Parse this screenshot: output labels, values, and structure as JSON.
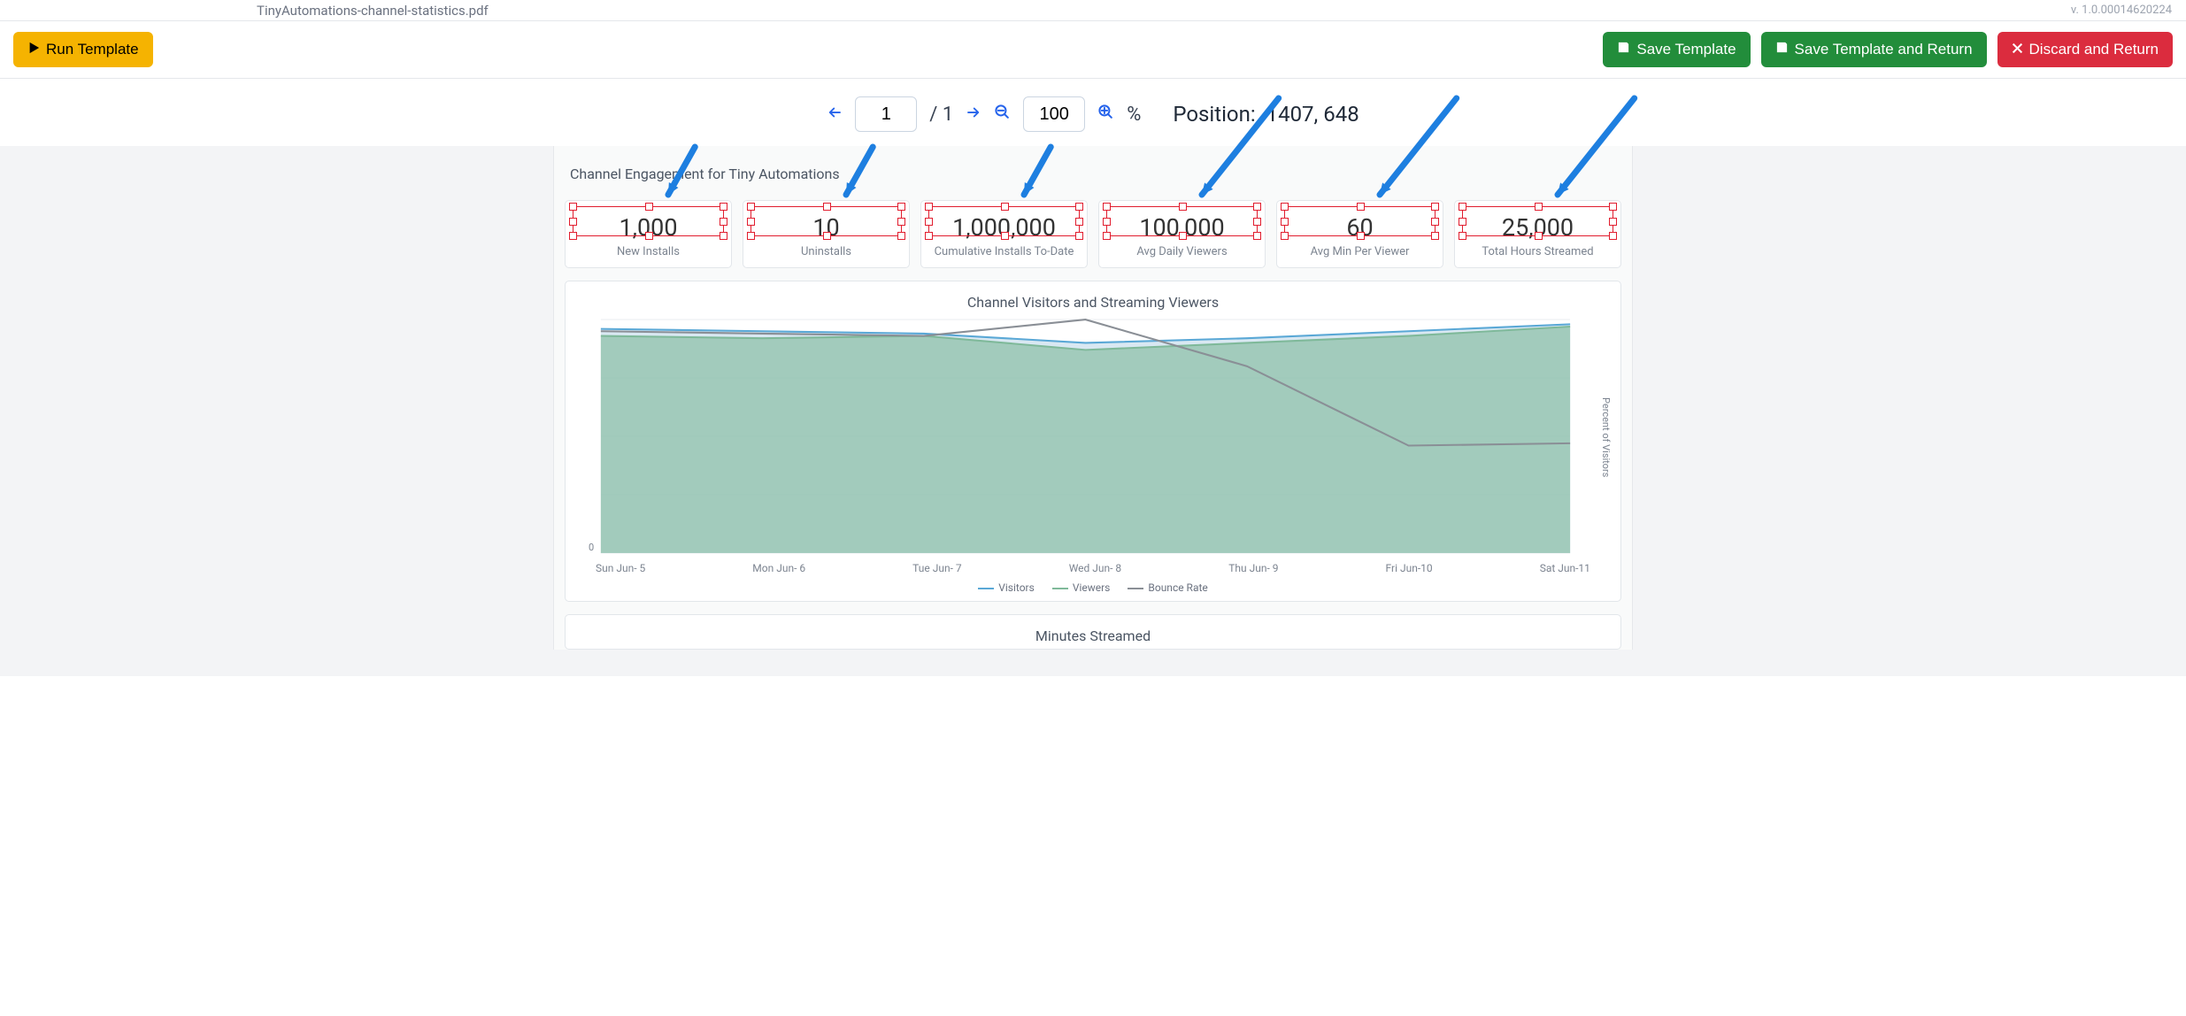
{
  "tab": {
    "filename": "TinyAutomations-channel-statistics.pdf",
    "version": "v. 1.0.00014620224"
  },
  "toolbar": {
    "run_label": "Run Template",
    "save_label": "Save Template",
    "save_return_label": "Save Template and Return",
    "discard_label": "Discard and Return"
  },
  "viewer": {
    "page_current": "1",
    "page_total": "1",
    "zoom": "100",
    "position_label": "Position:",
    "position_value": "1407, 648"
  },
  "report": {
    "title": "Channel Engagement for Tiny Automations",
    "kpis": [
      {
        "value": "1,000",
        "label": "New Installs"
      },
      {
        "value": "10",
        "label": "Uninstalls"
      },
      {
        "value": "1,000,000",
        "label": "Cumulative Installs To-Date"
      },
      {
        "value": "100,000",
        "label": "Avg Daily Viewers"
      },
      {
        "value": "60",
        "label": "Avg Min Per Viewer"
      },
      {
        "value": "25,000",
        "label": "Total Hours Streamed"
      }
    ],
    "chart1": {
      "title": "Channel Visitors and Streaming Viewers",
      "y_right": "Percent of Visitors",
      "zero": "0",
      "legend": [
        {
          "name": "Visitors",
          "color": "#5aa8d6"
        },
        {
          "name": "Viewers",
          "color": "#7fb99a"
        },
        {
          "name": "Bounce Rate",
          "color": "#8a8f96"
        }
      ]
    },
    "chart2": {
      "title": "Minutes Streamed"
    }
  },
  "chart_data": {
    "type": "area",
    "categories": [
      "Sun Jun- 5",
      "Mon Jun- 6",
      "Tue Jun- 7",
      "Wed Jun- 8",
      "Thu Jun- 9",
      "Fri Jun-10",
      "Sat Jun-11"
    ],
    "series": [
      {
        "name": "Visitors",
        "values": [
          96,
          95,
          94,
          90,
          92,
          95,
          98
        ]
      },
      {
        "name": "Viewers",
        "values": [
          93,
          92,
          93,
          87,
          90,
          93,
          97
        ]
      },
      {
        "name": "Bounce Rate",
        "values": [
          95,
          94,
          93,
          100,
          80,
          46,
          47
        ]
      }
    ],
    "title": "Channel Visitors and Streaming Viewers",
    "ylabel": "Percent of Visitors",
    "ylim": [
      0,
      100
    ]
  }
}
